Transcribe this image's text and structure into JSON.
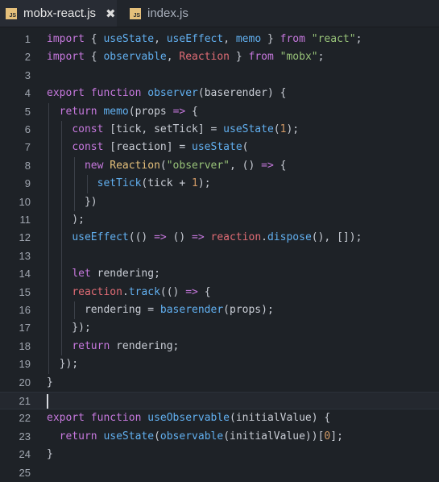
{
  "tabs": [
    {
      "name": "mobx-react.js",
      "badge": "JS",
      "active": true,
      "close": "✖"
    },
    {
      "name": "index.js",
      "badge": "JS",
      "active": false
    }
  ],
  "colors": {
    "keyword": "#c678dd",
    "function": "#61afef",
    "string": "#98c379",
    "number": "#d19a66",
    "class": "#e5c07b",
    "variable": "#e06c75",
    "text": "#c8ccd4"
  },
  "editor": {
    "cursor_line": 21,
    "lines": [
      {
        "n": "1",
        "tokens": [
          [
            "kw",
            "import"
          ],
          [
            "plain",
            " { "
          ],
          [
            "fn",
            "useState"
          ],
          [
            "plain",
            ", "
          ],
          [
            "fn",
            "useEffect"
          ],
          [
            "plain",
            ", "
          ],
          [
            "fn",
            "memo"
          ],
          [
            "plain",
            " } "
          ],
          [
            "kw",
            "from"
          ],
          [
            "plain",
            " "
          ],
          [
            "str",
            "\"react\""
          ],
          [
            "plain",
            ";"
          ]
        ]
      },
      {
        "n": "2",
        "tokens": [
          [
            "kw",
            "import"
          ],
          [
            "plain",
            " { "
          ],
          [
            "fn",
            "observable"
          ],
          [
            "plain",
            ", "
          ],
          [
            "red",
            "Reaction"
          ],
          [
            "plain",
            " } "
          ],
          [
            "kw",
            "from"
          ],
          [
            "plain",
            " "
          ],
          [
            "str",
            "\"mobx\""
          ],
          [
            "plain",
            ";"
          ]
        ]
      },
      {
        "n": "3",
        "tokens": []
      },
      {
        "n": "4",
        "tokens": [
          [
            "kw",
            "export"
          ],
          [
            "plain",
            " "
          ],
          [
            "kw",
            "function"
          ],
          [
            "plain",
            " "
          ],
          [
            "fn",
            "observer"
          ],
          [
            "plain",
            "(baserender) {"
          ]
        ]
      },
      {
        "n": "5",
        "tokens": [
          [
            "plain",
            "  "
          ],
          [
            "kw",
            "return"
          ],
          [
            "plain",
            " "
          ],
          [
            "fn",
            "memo"
          ],
          [
            "plain",
            "(props "
          ],
          [
            "op",
            "=>"
          ],
          [
            "plain",
            " {"
          ]
        ]
      },
      {
        "n": "6",
        "tokens": [
          [
            "plain",
            "    "
          ],
          [
            "kw",
            "const"
          ],
          [
            "plain",
            " [tick, setTick] = "
          ],
          [
            "fn",
            "useState"
          ],
          [
            "plain",
            "("
          ],
          [
            "num",
            "1"
          ],
          [
            "plain",
            ");"
          ]
        ]
      },
      {
        "n": "7",
        "tokens": [
          [
            "plain",
            "    "
          ],
          [
            "kw",
            "const"
          ],
          [
            "plain",
            " [reaction] = "
          ],
          [
            "fn",
            "useState"
          ],
          [
            "plain",
            "("
          ]
        ]
      },
      {
        "n": "8",
        "tokens": [
          [
            "plain",
            "      "
          ],
          [
            "kw",
            "new"
          ],
          [
            "plain",
            " "
          ],
          [
            "cls",
            "Reaction"
          ],
          [
            "plain",
            "("
          ],
          [
            "str",
            "\"observer\""
          ],
          [
            "plain",
            ", () "
          ],
          [
            "op",
            "=>"
          ],
          [
            "plain",
            " {"
          ]
        ]
      },
      {
        "n": "9",
        "tokens": [
          [
            "plain",
            "        "
          ],
          [
            "fn",
            "setTick"
          ],
          [
            "plain",
            "(tick + "
          ],
          [
            "num",
            "1"
          ],
          [
            "plain",
            ");"
          ]
        ]
      },
      {
        "n": "10",
        "tokens": [
          [
            "plain",
            "      })"
          ]
        ]
      },
      {
        "n": "11",
        "tokens": [
          [
            "plain",
            "    );"
          ]
        ]
      },
      {
        "n": "12",
        "tokens": [
          [
            "plain",
            "    "
          ],
          [
            "fn",
            "useEffect"
          ],
          [
            "plain",
            "(() "
          ],
          [
            "op",
            "=>"
          ],
          [
            "plain",
            " () "
          ],
          [
            "op",
            "=>"
          ],
          [
            "plain",
            " "
          ],
          [
            "red",
            "reaction"
          ],
          [
            "plain",
            "."
          ],
          [
            "fn",
            "dispose"
          ],
          [
            "plain",
            "(), []);"
          ]
        ]
      },
      {
        "n": "13",
        "tokens": []
      },
      {
        "n": "14",
        "tokens": [
          [
            "plain",
            "    "
          ],
          [
            "kw",
            "let"
          ],
          [
            "plain",
            " rendering;"
          ]
        ]
      },
      {
        "n": "15",
        "tokens": [
          [
            "plain",
            "    "
          ],
          [
            "red",
            "reaction"
          ],
          [
            "plain",
            "."
          ],
          [
            "fn",
            "track"
          ],
          [
            "plain",
            "(() "
          ],
          [
            "op",
            "=>"
          ],
          [
            "plain",
            " {"
          ]
        ]
      },
      {
        "n": "16",
        "tokens": [
          [
            "plain",
            "      rendering = "
          ],
          [
            "fn",
            "baserender"
          ],
          [
            "plain",
            "(props);"
          ]
        ]
      },
      {
        "n": "17",
        "tokens": [
          [
            "plain",
            "    });"
          ]
        ]
      },
      {
        "n": "18",
        "tokens": [
          [
            "plain",
            "    "
          ],
          [
            "kw",
            "return"
          ],
          [
            "plain",
            " rendering;"
          ]
        ]
      },
      {
        "n": "19",
        "tokens": [
          [
            "plain",
            "  });"
          ]
        ]
      },
      {
        "n": "20",
        "tokens": [
          [
            "plain",
            "}"
          ]
        ]
      },
      {
        "n": "21",
        "tokens": []
      },
      {
        "n": "22",
        "tokens": [
          [
            "kw",
            "export"
          ],
          [
            "plain",
            " "
          ],
          [
            "kw",
            "function"
          ],
          [
            "plain",
            " "
          ],
          [
            "fn",
            "useObservable"
          ],
          [
            "plain",
            "(initialValue) {"
          ]
        ]
      },
      {
        "n": "23",
        "tokens": [
          [
            "plain",
            "  "
          ],
          [
            "kw",
            "return"
          ],
          [
            "plain",
            " "
          ],
          [
            "fn",
            "useState"
          ],
          [
            "plain",
            "("
          ],
          [
            "fn",
            "observable"
          ],
          [
            "plain",
            "(initialValue))["
          ],
          [
            "num",
            "0"
          ],
          [
            "plain",
            "];"
          ]
        ]
      },
      {
        "n": "24",
        "tokens": [
          [
            "plain",
            "}"
          ]
        ]
      },
      {
        "n": "25",
        "tokens": []
      }
    ]
  }
}
